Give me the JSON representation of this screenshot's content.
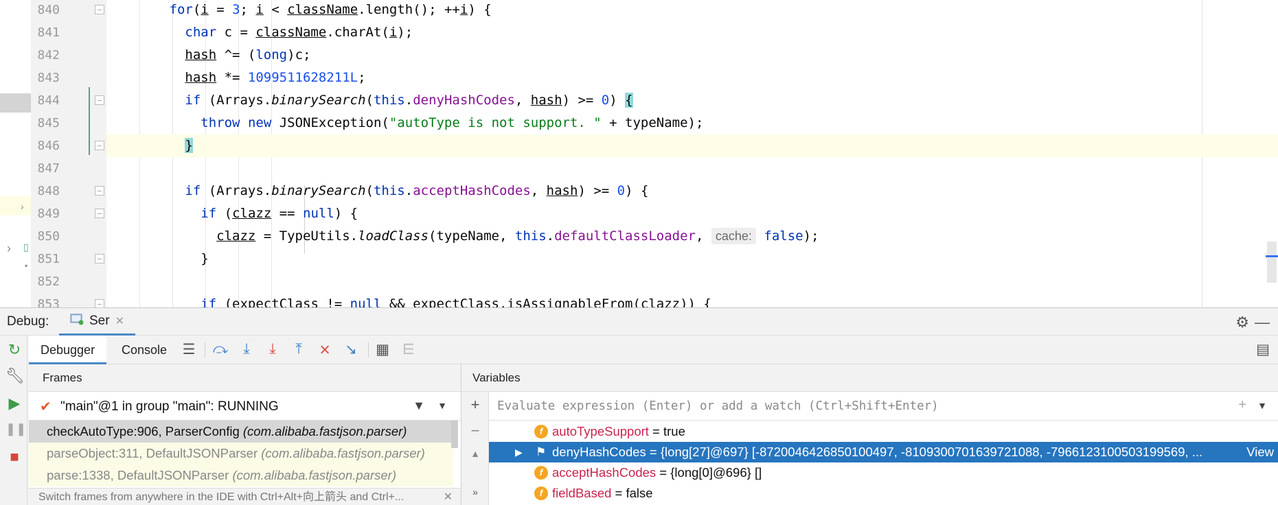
{
  "editor": {
    "lines": [
      {
        "num": "840",
        "text": "for(i = 3; i < className.length(); ++i) {"
      },
      {
        "num": "841",
        "text": "char c = className.charAt(i);"
      },
      {
        "num": "842",
        "text": "hash ^= (long)c;"
      },
      {
        "num": "843",
        "text": "hash *= 1099511628211L;"
      },
      {
        "num": "844",
        "text": "if (Arrays.binarySearch(this.denyHashCodes, hash) >= 0) {"
      },
      {
        "num": "845",
        "text": "throw new JSONException(\"autoType is not support. \" + typeName);"
      },
      {
        "num": "846",
        "text": "}"
      },
      {
        "num": "847",
        "text": ""
      },
      {
        "num": "848",
        "text": "if (Arrays.binarySearch(this.acceptHashCodes, hash) >= 0) {"
      },
      {
        "num": "849",
        "text": "if (clazz == null) {"
      },
      {
        "num": "850",
        "text": "clazz = TypeUtils.loadClass(typeName, this.defaultClassLoader, cache: false);"
      },
      {
        "num": "851",
        "text": "}"
      },
      {
        "num": "852",
        "text": ""
      },
      {
        "num": "853",
        "text": "if (expectClass != null && expectClass.isAssignableFrom(clazz)) {"
      }
    ],
    "inlay_hint": "cache:"
  },
  "debug": {
    "title": "Debug:",
    "run_tab": "Ser",
    "tabs": [
      "Debugger",
      "Console"
    ],
    "frames": {
      "title": "Frames",
      "thread": "\"main\"@1 in group \"main\": RUNNING",
      "items": [
        {
          "method": "checkAutoType:906, ParserConfig",
          "pkg": "(com.alibaba.fastjson.parser)"
        },
        {
          "method": "parseObject:311, DefaultJSONParser",
          "pkg": "(com.alibaba.fastjson.parser)"
        },
        {
          "method": "parse:1338, DefaultJSONParser",
          "pkg": "(com.alibaba.fastjson.parser)"
        }
      ],
      "hint": "Switch frames from anywhere in the IDE with Ctrl+Alt+向上箭头 and Ctrl+..."
    },
    "variables": {
      "title": "Variables",
      "eval_placeholder": "Evaluate expression (Enter) or add a watch (Ctrl+Shift+Enter)",
      "items": [
        {
          "name": "autoTypeSupport",
          "value": " = true"
        },
        {
          "name": "denyHashCodes",
          "value": " = {long[27]@697} [-8720046426850100497, -8109300701639721088, -7966123100503199569, ...",
          "link": "View"
        },
        {
          "name": "acceptHashCodes",
          "value": " = {long[0]@696} []"
        },
        {
          "name": "fieldBased",
          "value": " = false"
        }
      ]
    }
  },
  "colors": {
    "keyword": "#0033b3",
    "field": "#871094",
    "number": "#1750eb",
    "string": "#067d17",
    "selection": "#2675bf",
    "tab_underline": "#4a88c7"
  }
}
